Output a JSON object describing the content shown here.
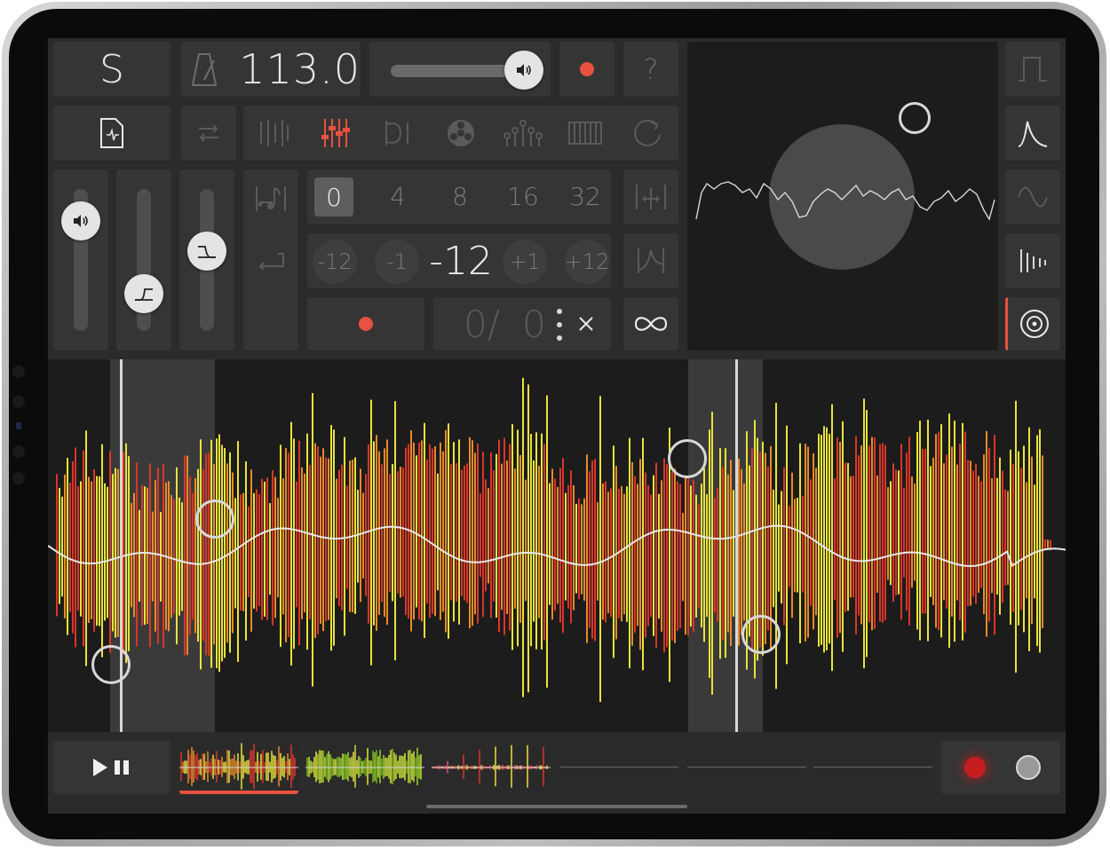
{
  "header": {
    "mode_label": "S",
    "bpm_value": "113.0"
  },
  "quantize": {
    "options": [
      "0",
      "4",
      "8",
      "16",
      "32"
    ],
    "selected": "0"
  },
  "transpose": {
    "buttons": [
      "-12",
      "-1",
      "+1",
      "+12"
    ],
    "value": "-12"
  },
  "loop": {
    "counter_left": "0/",
    "counter_right": "0"
  },
  "help_label": "?",
  "colors": {
    "accent_red": "#e8513f",
    "panel": "#353535",
    "background": "#2b2b2b",
    "waveform_yellow": "#e8e23c",
    "waveform_orange": "#e88a2a",
    "waveform_red": "#d9362a"
  },
  "icons": {
    "file": "file-icon",
    "metronome": "metronome-icon",
    "volume": "speaker-icon",
    "record": "record-dot-icon",
    "infinity": "infinity-icon",
    "close": "close-icon",
    "play_pause": "play-pause-icon"
  }
}
